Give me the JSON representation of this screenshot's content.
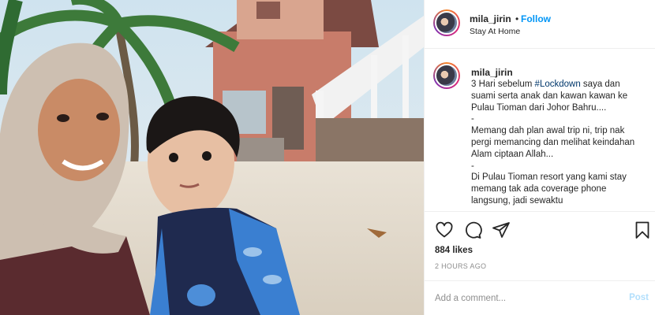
{
  "post": {
    "username": "mila_jirin",
    "separator": "•",
    "follow_label": "Follow",
    "location": "Stay At Home"
  },
  "caption": {
    "username": "mila_jirin",
    "line1_pre": "3 Hari sebelum ",
    "hashtag": "#Lockdown",
    "line1_post": " saya dan suami serta anak dan kawan kawan ke Pulau Tioman dari Johor Bahru....",
    "sep1": "-",
    "para2": "Memang dah plan awal trip ni, trip nak pergi memancing dan melihat keindahan Alam ciptaan Allah...",
    "sep2": "-",
    "para3": "Di Pulau Tioman resort yang kami stay memang tak ada coverage phone langsung, jadi sewaktu"
  },
  "actions": {
    "icons": [
      "heart-icon",
      "comment-icon",
      "share-icon",
      "bookmark-icon"
    ],
    "likes": "884 likes",
    "time": "2 HOURS AGO"
  },
  "comment": {
    "placeholder": "Add a comment...",
    "post_label": "Post"
  },
  "colors": {
    "follow": "#0095f6",
    "hashtag": "#00376b",
    "post_disabled": "#b2dffc",
    "muted": "#8e8e8e",
    "divider": "#efefef"
  }
}
